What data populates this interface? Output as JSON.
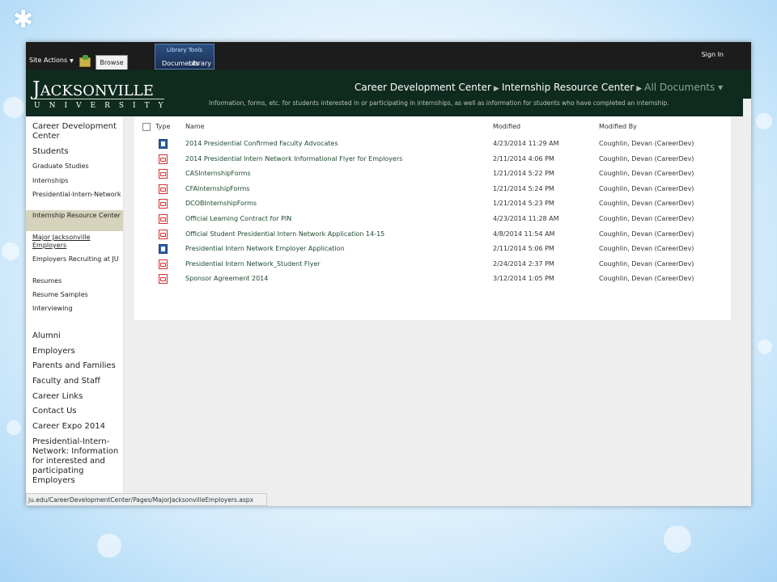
{
  "ribbon": {
    "site_actions": "Site Actions",
    "browse": "Browse",
    "library_tools": "Library Tools",
    "documents": "Documents",
    "library": "Library",
    "sign_in": "Sign In"
  },
  "header": {
    "logo_main_first": "J",
    "logo_main_rest": "ACKSONVILLE",
    "logo_sub": "UNIVERSITY",
    "breadcrumb": [
      "Career Development Center",
      "Internship Resource Center",
      "All Documents"
    ],
    "breadcrumb_dropdown": "▾",
    "description": "Information, forms, etc. for students interested in or participating in internships, as well as information for students who have completed an internship."
  },
  "nav": {
    "items": [
      {
        "label": "Career Development Center"
      },
      {
        "label": "Students"
      },
      {
        "label": "Graduate Studies"
      },
      {
        "label": "Internships"
      },
      {
        "label": "Presidential-Intern-Network"
      },
      {
        "label": "Internship Resource Center"
      },
      {
        "label": "Major Jacksonville Employers"
      },
      {
        "label": "Employers Recruiting at JU"
      },
      {
        "label": "Resumes"
      },
      {
        "label": "Resume Samples"
      },
      {
        "label": "Interviewing"
      },
      {
        "label": "Alumni"
      },
      {
        "label": "Employers"
      },
      {
        "label": "Parents and Families"
      },
      {
        "label": "Faculty and Staff"
      },
      {
        "label": "Career Links"
      },
      {
        "label": "Contact Us"
      },
      {
        "label": "Career Expo 2014"
      },
      {
        "label": "Presidential-Intern-Network: Information for interested and participating Employers"
      }
    ]
  },
  "table": {
    "headers": {
      "type": "Type",
      "name": "Name",
      "modified": "Modified",
      "modified_by": "Modified By"
    },
    "rows": [
      {
        "icon": "word-doc-icon",
        "name": "2014 Presidential Confirmed Faculty Advocates",
        "modified": "4/23/2014 11:29 AM",
        "modified_by": "Coughlin, Devan (CareerDev)"
      },
      {
        "icon": "pdf-icon",
        "name": "2014 Presidential Intern Network Informational Flyer for Employers",
        "modified": "2/11/2014 4:06 PM",
        "modified_by": "Coughlin, Devan (CareerDev)"
      },
      {
        "icon": "pdf-icon",
        "name": "CASInternshipForms",
        "modified": "1/21/2014 5:22 PM",
        "modified_by": "Coughlin, Devan (CareerDev)"
      },
      {
        "icon": "pdf-icon",
        "name": "CFAInternshipForms",
        "modified": "1/21/2014 5:24 PM",
        "modified_by": "Coughlin, Devan (CareerDev)"
      },
      {
        "icon": "pdf-icon",
        "name": "DCOBInternshipForms",
        "modified": "1/21/2014 5:23 PM",
        "modified_by": "Coughlin, Devan (CareerDev)"
      },
      {
        "icon": "pdf-icon",
        "name": "Official Learning Contract for PIN",
        "modified": "4/23/2014 11:28 AM",
        "modified_by": "Coughlin, Devan (CareerDev)"
      },
      {
        "icon": "pdf-icon",
        "name": "Official Student Presidential Intern Network Application 14-15",
        "modified": "4/8/2014 11:54 AM",
        "modified_by": "Coughlin, Devan (CareerDev)"
      },
      {
        "icon": "word-doc-icon",
        "name": "Presidential Intern Network Employer Application",
        "modified": "2/11/2014 5:06 PM",
        "modified_by": "Coughlin, Devan (CareerDev)"
      },
      {
        "icon": "pdf-icon",
        "name": "Presidential Intern Network_Student Flyer",
        "modified": "2/24/2014 2:37 PM",
        "modified_by": "Coughlin, Devan (CareerDev)"
      },
      {
        "icon": "pdf-icon",
        "name": "Sponsor Agreement 2014",
        "modified": "3/12/2014 1:05 PM",
        "modified_by": "Coughlin, Devan (CareerDev)"
      }
    ]
  },
  "statusbar": {
    "url": "ju.edu/CareerDevelopmentCenter/Pages/MajorJacksonvilleEmployers.aspx"
  },
  "colors": {
    "header_bg": "#0f2a1e",
    "selected_nav": "#d6d3bc",
    "link_green": "#1e4a2f",
    "ribbon_bg": "#1c1c1c"
  }
}
